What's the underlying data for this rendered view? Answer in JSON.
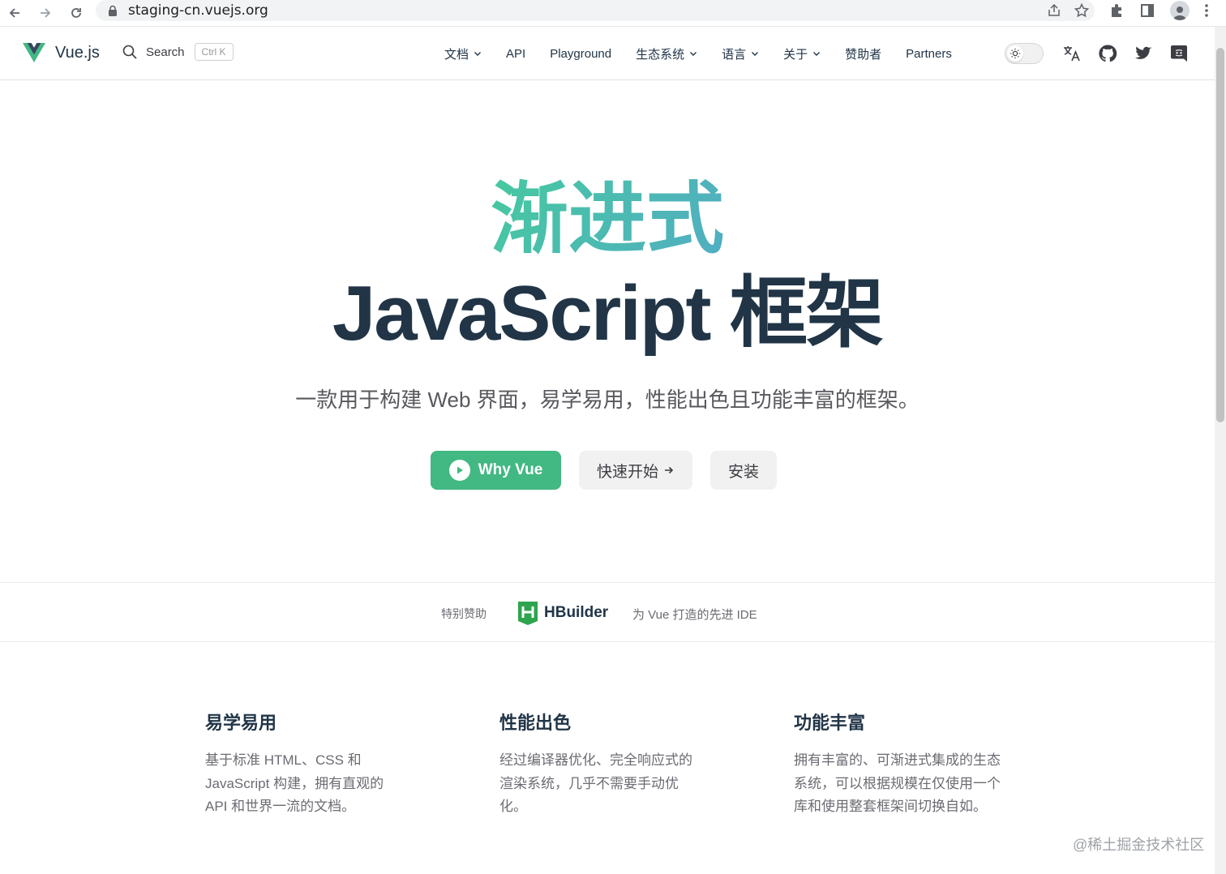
{
  "browser": {
    "url": "staging-cn.vuejs.org",
    "icons": [
      "back-arrow-icon",
      "forward-arrow-icon",
      "reload-icon",
      "lock-icon",
      "share-icon",
      "star-icon",
      "puzzle-icon",
      "sidepanel-icon",
      "profile-icon",
      "kebab-menu-icon"
    ]
  },
  "nav": {
    "brand": "Vue.js",
    "search_label": "Search",
    "search_shortcut": "Ctrl K",
    "items": [
      {
        "label": "文档",
        "dropdown": true
      },
      {
        "label": "API",
        "dropdown": false
      },
      {
        "label": "Playground",
        "dropdown": false
      },
      {
        "label": "生态系统",
        "dropdown": true
      },
      {
        "label": "语言",
        "dropdown": true
      },
      {
        "label": "关于",
        "dropdown": true
      },
      {
        "label": "赞助者",
        "dropdown": false
      },
      {
        "label": "Partners",
        "dropdown": false
      }
    ],
    "social": [
      "translate-icon",
      "github-icon",
      "twitter-icon",
      "discord-icon"
    ]
  },
  "hero": {
    "tagline": "渐进式",
    "title": "JavaScript 框架",
    "description": "一款用于构建 Web 界面，易学易用，性能出色且功能丰富的框架。",
    "why_vue": "Why Vue",
    "quick_start": "快速开始",
    "install": "安装"
  },
  "sponsor": {
    "label": "特别赞助",
    "name": "HBuilder",
    "tagline": "为 Vue 打造的先进 IDE"
  },
  "features": [
    {
      "title": "易学易用",
      "text": "基于标准 HTML、CSS 和 JavaScript 构建，拥有直观的 API 和世界一流的文档。"
    },
    {
      "title": "性能出色",
      "text": "经过编译器优化、完全响应式的渲染系统，几乎不需要手动优化。"
    },
    {
      "title": "功能丰富",
      "text": "拥有丰富的、可渐进式集成的生态系统，可以根据规模在仅使用一个库和使用整套框架间切换自如。"
    }
  ],
  "watermark": "@稀土掘金技术社区",
  "colors": {
    "brand_green": "#42b883",
    "text_dark": "#213547",
    "gradient_start": "#42d392",
    "gradient_end": "#647eff"
  }
}
